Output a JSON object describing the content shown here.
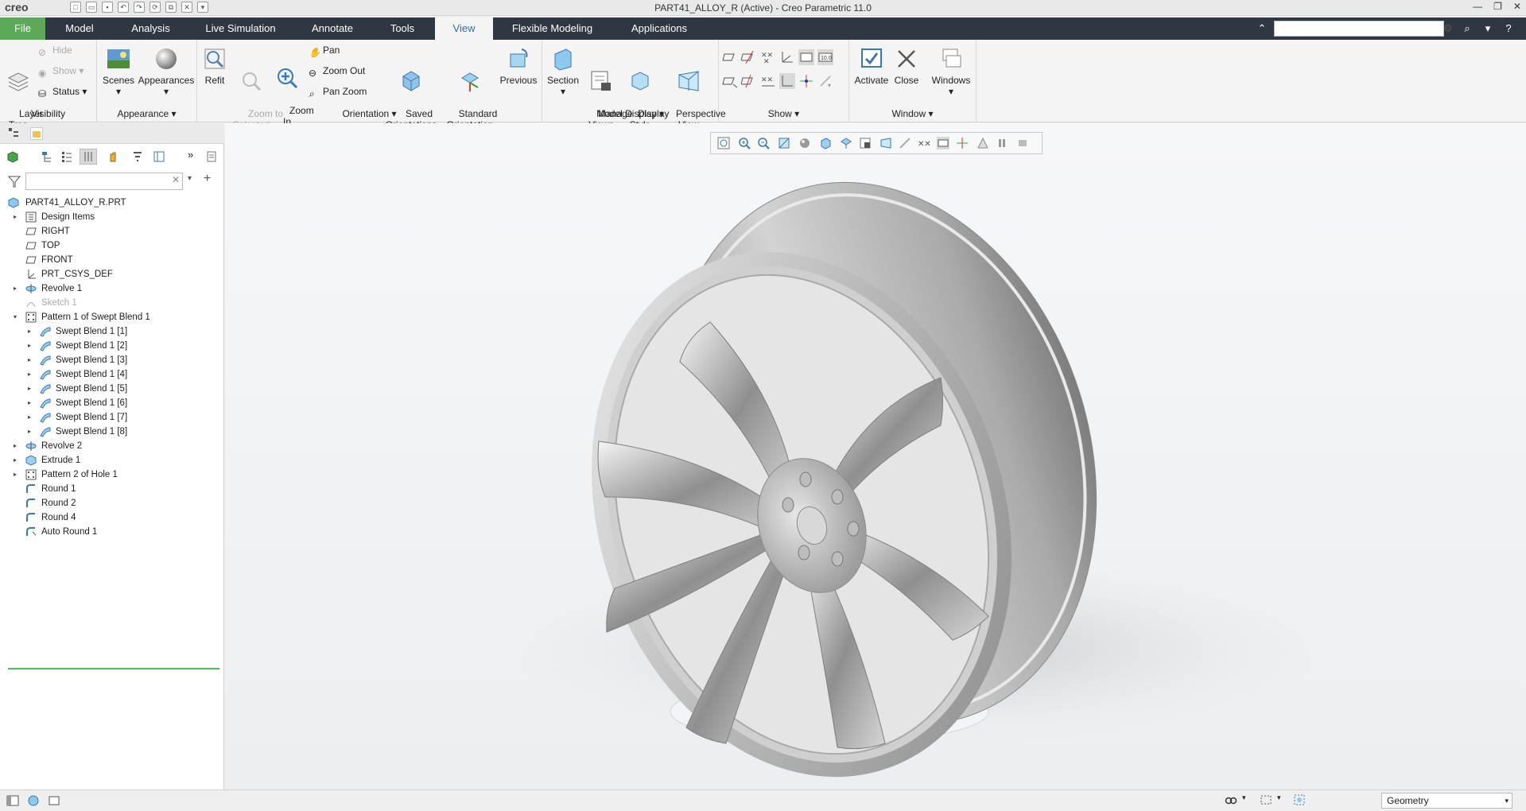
{
  "app": {
    "logo": "creo",
    "title": "PART41_ALLOY_R (Active) - Creo Parametric 11.0"
  },
  "tabs": [
    {
      "label": "File"
    },
    {
      "label": "Model"
    },
    {
      "label": "Analysis"
    },
    {
      "label": "Live Simulation"
    },
    {
      "label": "Annotate"
    },
    {
      "label": "Tools"
    },
    {
      "label": "View"
    },
    {
      "label": "Flexible Modeling"
    },
    {
      "label": "Applications"
    }
  ],
  "ribbon": {
    "visibility": {
      "label": "Visibility",
      "layer_tree": "Layer\nTree",
      "hide": "Hide",
      "show": "Show",
      "status": "Status"
    },
    "appearance": {
      "label": "Appearance",
      "scenes": "Scenes",
      "appearances": "Appearances"
    },
    "orientation": {
      "label": "Orientation",
      "refit": "Refit",
      "zoom_selected": "Zoom to\nSelected",
      "zoom_in": "Zoom\nIn",
      "pan": "Pan",
      "zoom_out": "Zoom Out",
      "pan_zoom": "Pan Zoom",
      "saved": "Saved\nOrientations",
      "standard": "Standard\nOrientation",
      "previous": "Previous"
    },
    "model_display": {
      "label": "Model Display",
      "section": "Section",
      "manage_views": "Manage\nViews",
      "display_style": "Display\nStyle",
      "perspective": "Perspective\nView"
    },
    "show": {
      "label": "Show"
    },
    "window": {
      "label": "Window",
      "activate": "Activate",
      "close": "Close",
      "windows": "Windows"
    }
  },
  "tree": {
    "root": "PART41_ALLOY_R.PRT",
    "items": [
      {
        "label": "Design Items",
        "exp": "▸",
        "icon": "design-items",
        "level": 1
      },
      {
        "label": "RIGHT",
        "exp": "",
        "icon": "datum-plane",
        "level": 1
      },
      {
        "label": "TOP",
        "exp": "",
        "icon": "datum-plane",
        "level": 1
      },
      {
        "label": "FRONT",
        "exp": "",
        "icon": "datum-plane",
        "level": 1
      },
      {
        "label": "PRT_CSYS_DEF",
        "exp": "",
        "icon": "csys",
        "level": 1
      },
      {
        "label": "Revolve 1",
        "exp": "▸",
        "icon": "revolve",
        "level": 1
      },
      {
        "label": "Sketch 1",
        "exp": "",
        "icon": "sketch",
        "level": 1,
        "dim": true
      },
      {
        "label": "Pattern 1 of Swept Blend 1",
        "exp": "▾",
        "icon": "pattern",
        "level": 1
      },
      {
        "label": "Swept Blend 1 [1]",
        "exp": "▸",
        "icon": "swept-blend",
        "level": 2
      },
      {
        "label": "Swept Blend 1 [2]",
        "exp": "▸",
        "icon": "swept-blend",
        "level": 2
      },
      {
        "label": "Swept Blend 1 [3]",
        "exp": "▸",
        "icon": "swept-blend",
        "level": 2
      },
      {
        "label": "Swept Blend 1 [4]",
        "exp": "▸",
        "icon": "swept-blend",
        "level": 2
      },
      {
        "label": "Swept Blend 1 [5]",
        "exp": "▸",
        "icon": "swept-blend",
        "level": 2
      },
      {
        "label": "Swept Blend 1 [6]",
        "exp": "▸",
        "icon": "swept-blend",
        "level": 2
      },
      {
        "label": "Swept Blend 1 [7]",
        "exp": "▸",
        "icon": "swept-blend",
        "level": 2
      },
      {
        "label": "Swept Blend 1 [8]",
        "exp": "▸",
        "icon": "swept-blend",
        "level": 2
      },
      {
        "label": "Revolve 2",
        "exp": "▸",
        "icon": "revolve",
        "level": 1
      },
      {
        "label": "Extrude 1",
        "exp": "▸",
        "icon": "extrude",
        "level": 1
      },
      {
        "label": "Pattern 2 of Hole 1",
        "exp": "▸",
        "icon": "pattern",
        "level": 1
      },
      {
        "label": "Round 1",
        "exp": "",
        "icon": "round",
        "level": 1
      },
      {
        "label": "Round 2",
        "exp": "",
        "icon": "round",
        "level": 1
      },
      {
        "label": "Round 4",
        "exp": "",
        "icon": "round",
        "level": 1
      },
      {
        "label": "Auto Round 1",
        "exp": "",
        "icon": "auto-round",
        "level": 1
      }
    ]
  },
  "status": {
    "filter": "Geometry"
  },
  "colors": {
    "tabbar": "#2f3842",
    "file_tab": "#5ea85a",
    "active_tab_text": "#2c6fb0"
  }
}
